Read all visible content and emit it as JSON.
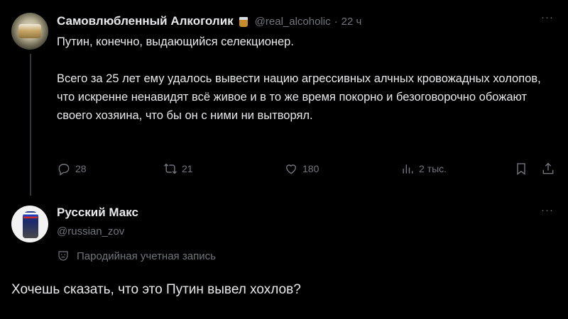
{
  "original_tweet": {
    "author_name": "Самовлюбленный Алкоголик",
    "author_emoji": "tumbler-glass-emoji",
    "handle": "@real_alcoholic",
    "separator": "·",
    "time": "22 ч",
    "more": "···",
    "text_p1": "Путин, конечно, выдающийся селекционер.",
    "text_p2": "Всего за 25 лет ему удалось вывести  нацию агрессивных алчных кровожадных холопов, что искренне ненавидят всё живое и в то же время покорно и безоговорочно обожают своего хозяина, что бы он с ними ни вытворял.",
    "actions": {
      "replies": "28",
      "retweets": "21",
      "likes": "180",
      "views": "2 тыс."
    }
  },
  "reply_tweet": {
    "author_name": "Русский Макс",
    "handle": "@russian_zov",
    "more": "···",
    "parody_label": "Пародийная учетная запись",
    "text": "Хочешь сказать, что это Путин вывел хохлов?"
  },
  "colors": {
    "background": "#000000",
    "text_primary": "#e7e9ea",
    "text_secondary": "#71767b",
    "thread_line": "#333639"
  }
}
